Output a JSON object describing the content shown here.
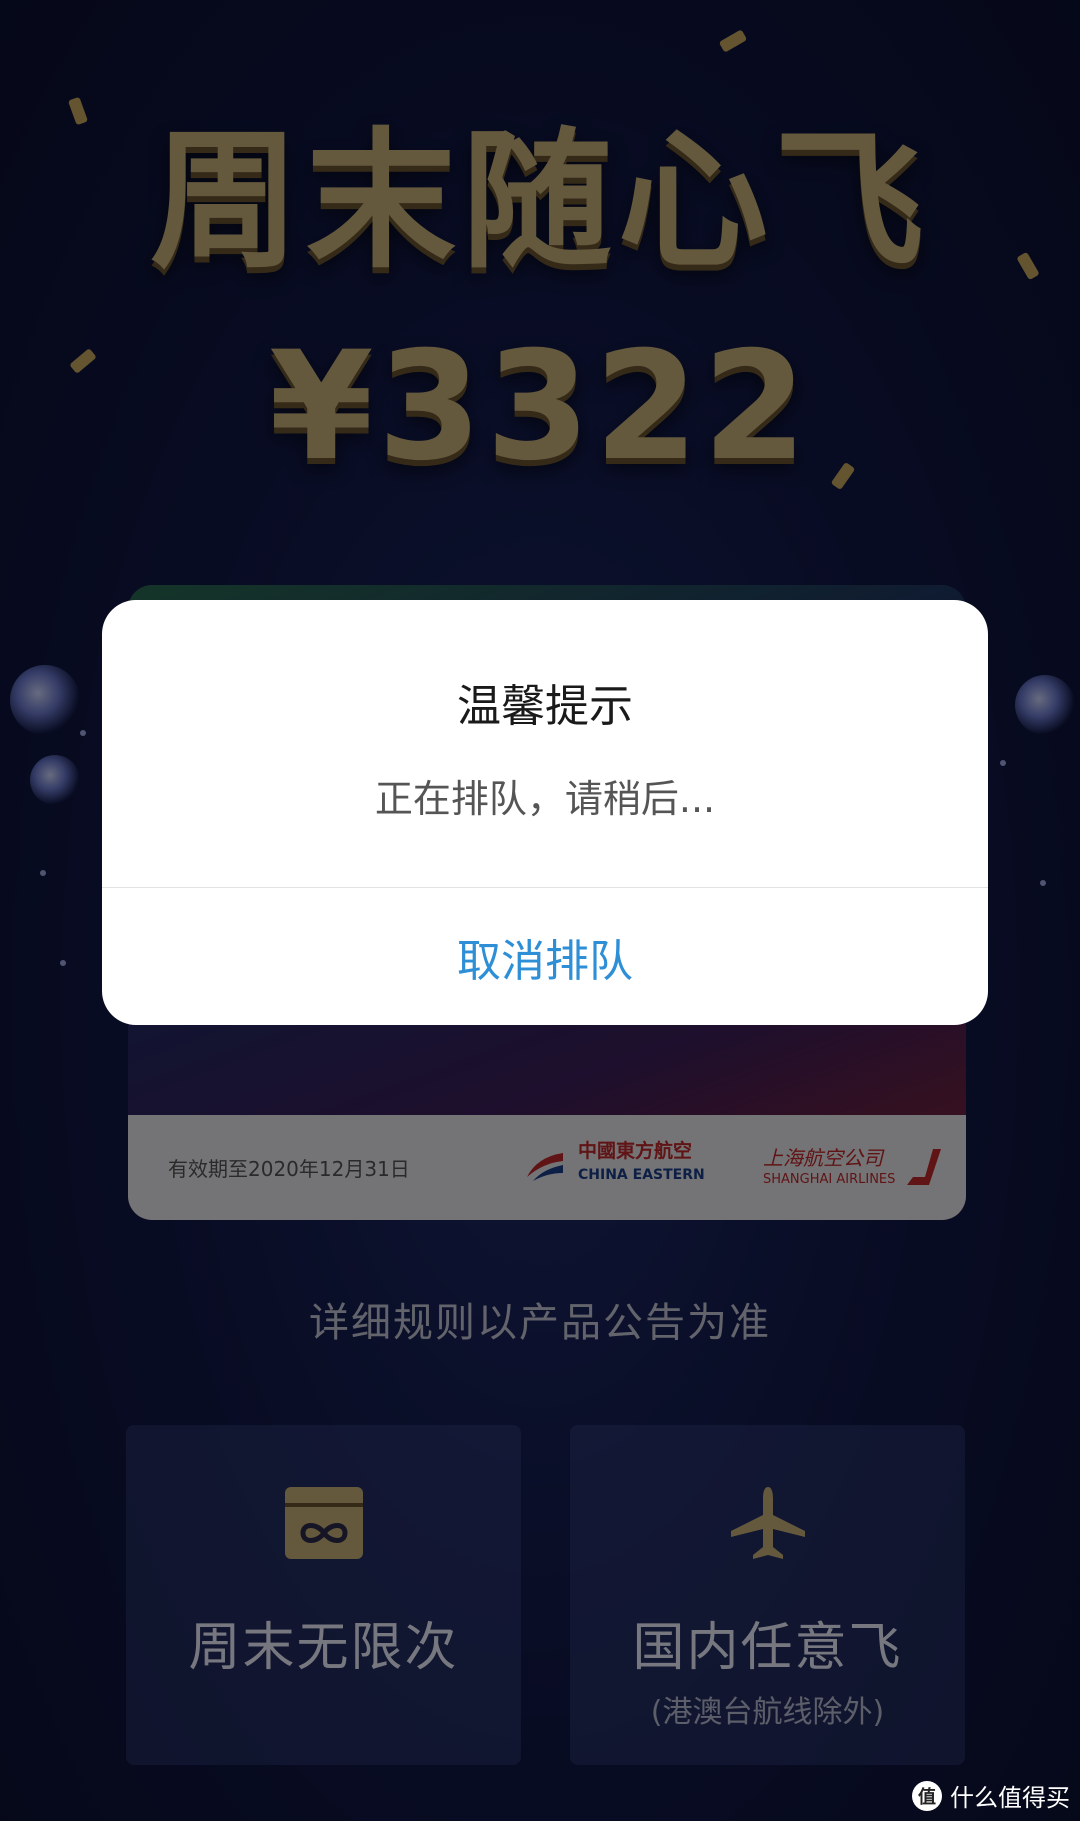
{
  "hero": {
    "title": "周末随心飞",
    "price": "¥3322"
  },
  "card": {
    "validity": "有效期至2020年12月31日",
    "airline1_cn": "中國東方航空",
    "airline1_en": "CHINA EASTERN",
    "airline2_cn": "上海航空公司",
    "airline2_en": "SHANGHAI AIRLINES"
  },
  "rules_note": "详细规则以产品公告为准",
  "features": [
    {
      "icon": "infinity-card-icon",
      "title": "周末无限次",
      "subtitle": ""
    },
    {
      "icon": "airplane-icon",
      "title": "国内任意飞",
      "subtitle": "(港澳台航线除外)"
    }
  ],
  "dialog": {
    "title": "温馨提示",
    "message": "正在排队，请稍后...",
    "action_label": "取消排队"
  },
  "watermark": {
    "icon_text": "值",
    "label": "什么值得买"
  },
  "colors": {
    "gold": "#c9b07a",
    "action_blue": "#2f8fd6",
    "airline_red": "#c0282a"
  }
}
